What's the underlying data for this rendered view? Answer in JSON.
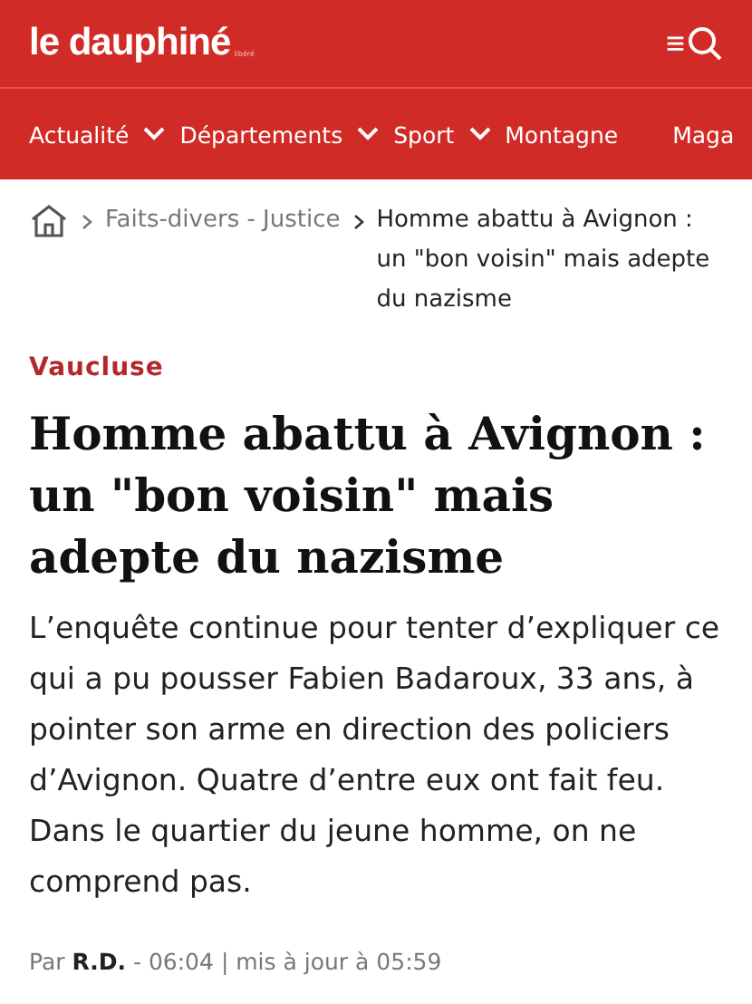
{
  "header": {
    "logo": "le dauphiné",
    "logo_sub": "libéré",
    "menu_glyph": "≡"
  },
  "nav": [
    {
      "label": "Actualité",
      "dropdown": true
    },
    {
      "label": "Départements",
      "dropdown": true
    },
    {
      "label": "Sport",
      "dropdown": true
    },
    {
      "label": "Montagne",
      "dropdown": false
    },
    {
      "label": "Maga",
      "dropdown": false
    }
  ],
  "breadcrumb": {
    "section": "Faits-divers - Justice",
    "current": "Homme abattu à Avignon : un \"bon voisin\" mais adepte du nazisme"
  },
  "article": {
    "category": "Vaucluse",
    "title": "Homme abattu à Avignon : un \"bon voisin\" mais adepte du nazisme",
    "lead": "L’enquête continue pour tenter d’expliquer ce qui a pu pousser Fabien Badaroux, 33 ans, à pointer son arme en direction des policiers d’Avignon. Quatre d’entre eux ont fait feu. Dans le quartier du jeune homme, on ne comprend pas.",
    "byline": "Par **R.D.** - 06:04 | mis à jour à 05:59"
  }
}
